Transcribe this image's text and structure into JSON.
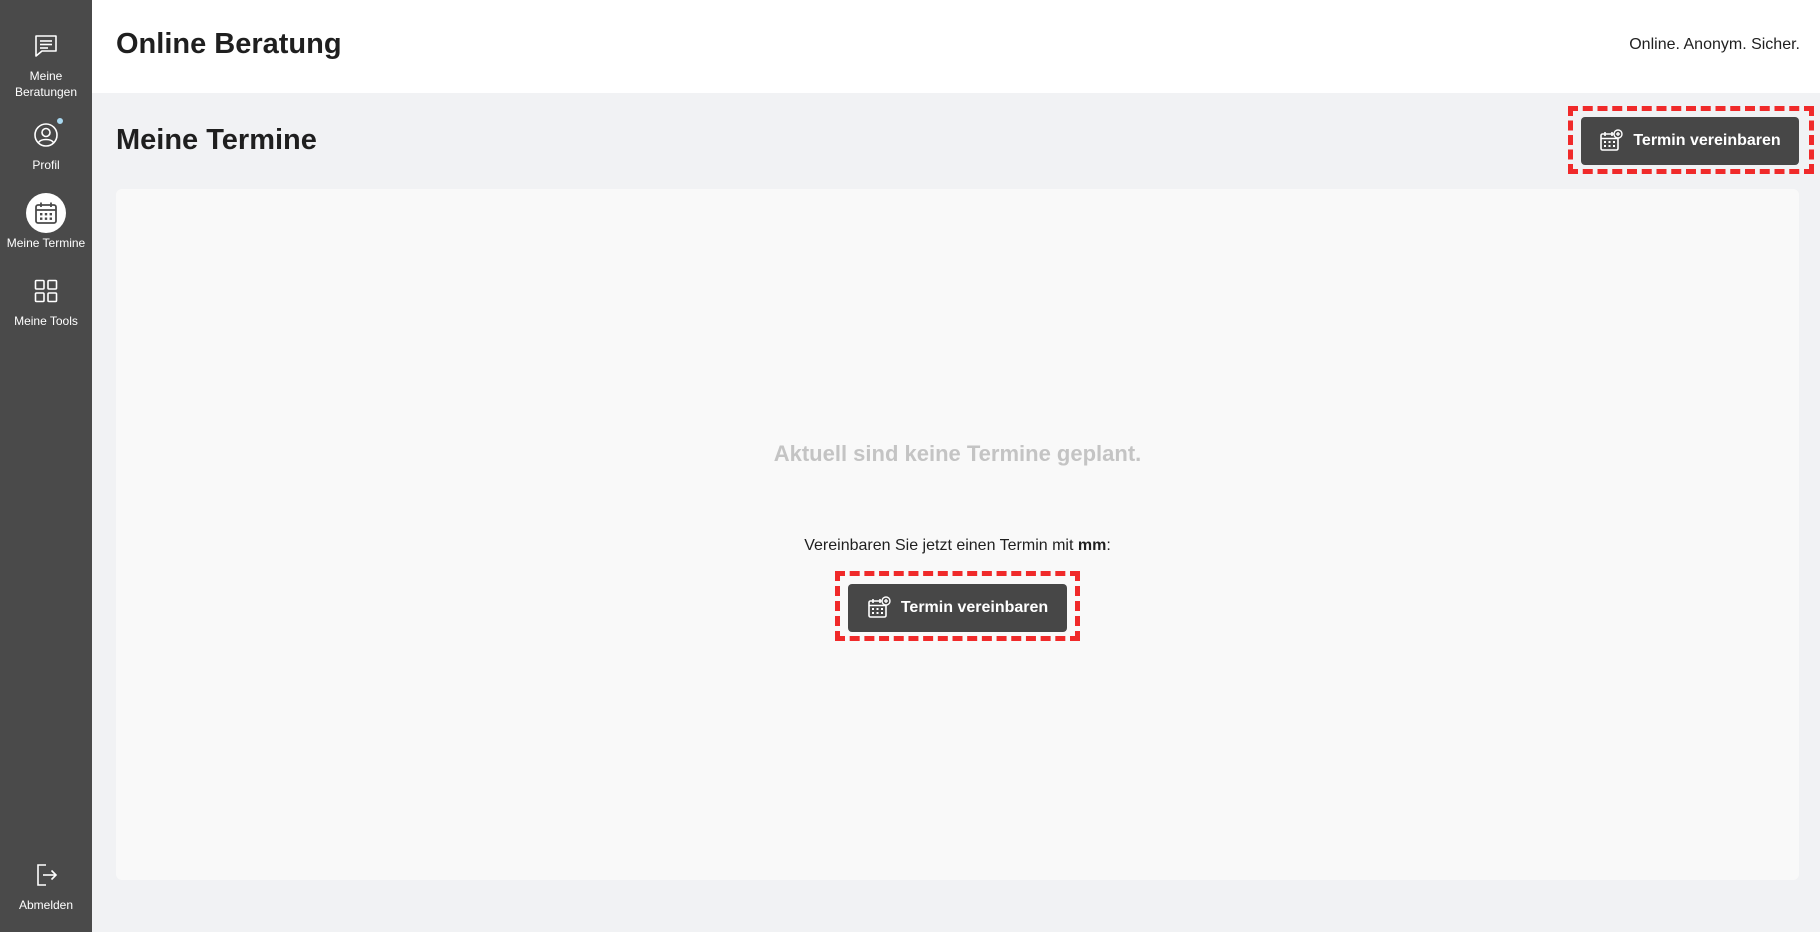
{
  "sidebar": {
    "items": [
      {
        "label": "Meine\nBeratungen",
        "icon": "chat-icon"
      },
      {
        "label": "Profil",
        "icon": "profile-icon"
      },
      {
        "label": "Meine Termine",
        "icon": "calendar-icon",
        "active": true
      },
      {
        "label": "Meine Tools",
        "icon": "grid-icon"
      }
    ],
    "logout_label": "Abmelden"
  },
  "header": {
    "title": "Online Beratung",
    "tagline": "Online. Anonym. Sicher."
  },
  "page": {
    "title": "Meine Termine",
    "book_button_label": "Termin vereinbaren",
    "empty_message": "Aktuell sind keine Termine geplant.",
    "invite_prefix": "Vereinbaren Sie jetzt einen Termin mit ",
    "invite_name": "mm",
    "invite_suffix": ":",
    "center_button_label": "Termin vereinbaren"
  },
  "colors": {
    "sidebar_bg": "#4a4a4a",
    "button_bg": "#474747",
    "highlight_dash": "#f02a2a",
    "notification_dot": "#a8d8f0"
  }
}
